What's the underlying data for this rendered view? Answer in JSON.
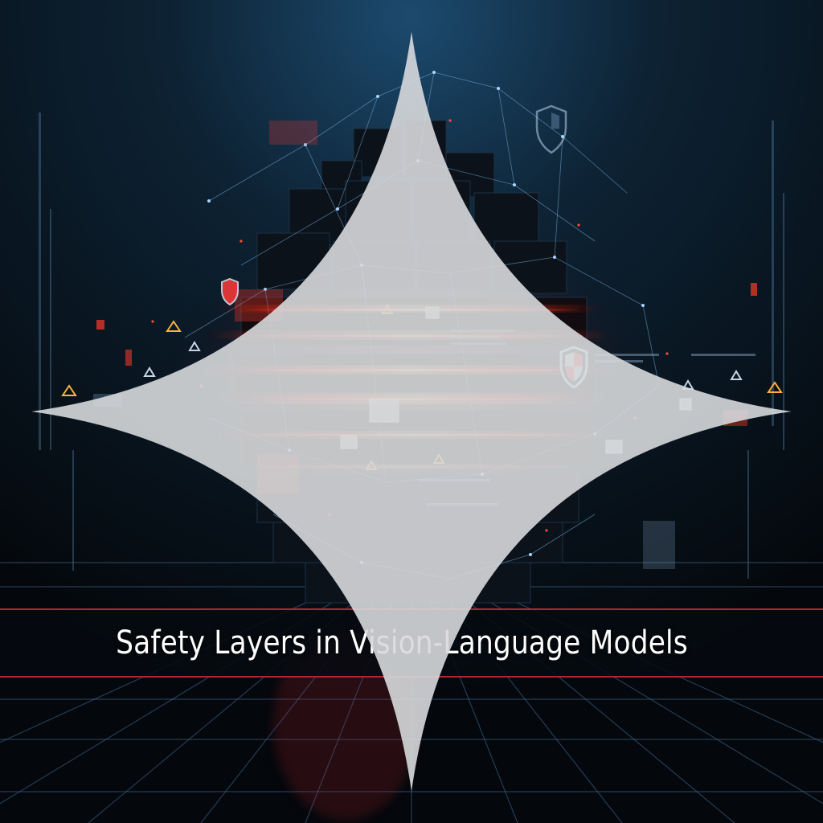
{
  "title": "Safety Layers in Vision-Language Models",
  "palette": {
    "background": "#05080d",
    "accent_red": "#ff3a2a",
    "accent_orange": "#ff8a3a",
    "network_blue": "#7fb8e8",
    "band_line": "#b8242a",
    "title_text": "#ffffff"
  },
  "icons": [
    "shield-icon",
    "warning-triangle-icon",
    "image-thumbnail-icon",
    "sparkle-icon"
  ]
}
